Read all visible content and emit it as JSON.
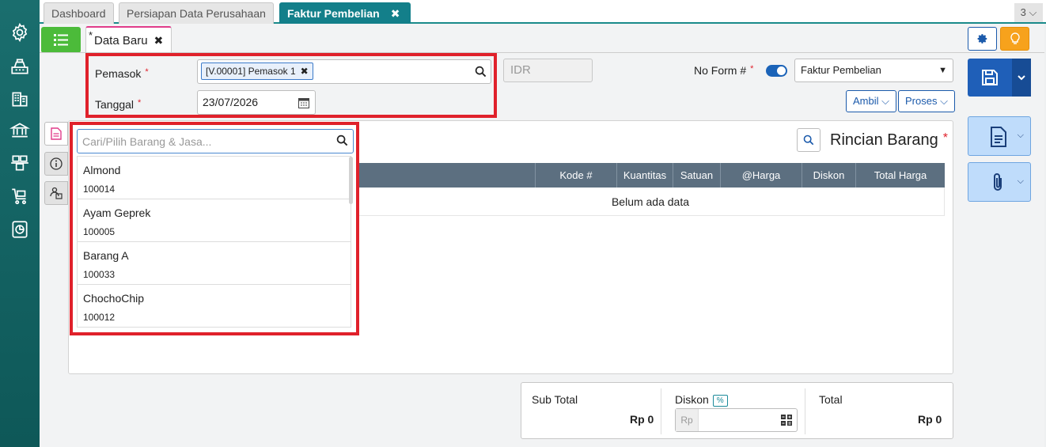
{
  "tabs": {
    "dashboard": "Dashboard",
    "persiapan": "Persiapan Data Perusahaan",
    "faktur": "Faktur Pembelian",
    "close_glyph": "✖",
    "count": "3 ⌵"
  },
  "subtab": {
    "asterisk": "*",
    "label": "Data Baru",
    "close_glyph": "✖"
  },
  "form": {
    "pemasok_label": "Pemasok",
    "required_mark": "*",
    "pemasok_chip": "[V.00001] Pemasok 1",
    "chip_close": "✖",
    "tanggal_label": "Tanggal",
    "tanggal_value": "23/07/2026",
    "currency": "IDR",
    "no_form_label": "No Form #",
    "form_type_selected": "Faktur Pembelian"
  },
  "buttons": {
    "ambil": "Ambil ⌵",
    "proses": "Proses ⌵"
  },
  "detail": {
    "title": "Rincian Barang",
    "columns": [
      "Kode #",
      "Kuantitas",
      "Satuan",
      "@Harga",
      "Diskon",
      "Total Harga"
    ],
    "empty_text": "Belum ada data"
  },
  "dropdown": {
    "placeholder": "Cari/Pilih Barang & Jasa...",
    "items": [
      {
        "name": "Almond",
        "code": "100014"
      },
      {
        "name": "Ayam Geprek",
        "code": "100005"
      },
      {
        "name": "Barang A",
        "code": "100033"
      },
      {
        "name": "ChochoChip",
        "code": "100012"
      }
    ]
  },
  "totals": {
    "subtotal_label": "Sub Total",
    "subtotal_value": "Rp 0",
    "diskon_label": "Diskon",
    "pct": "%",
    "rp_prefix": "Rp",
    "total_label": "Total",
    "total_value": "Rp 0"
  },
  "colors": {
    "sidebar": "#1a6e6e",
    "active_tab": "#137f8a",
    "primary": "#1f5fb8",
    "highlight_box": "#e0212b",
    "green": "#4cbb3a",
    "orange": "#f7a21c",
    "table_header": "#5c6f80"
  }
}
